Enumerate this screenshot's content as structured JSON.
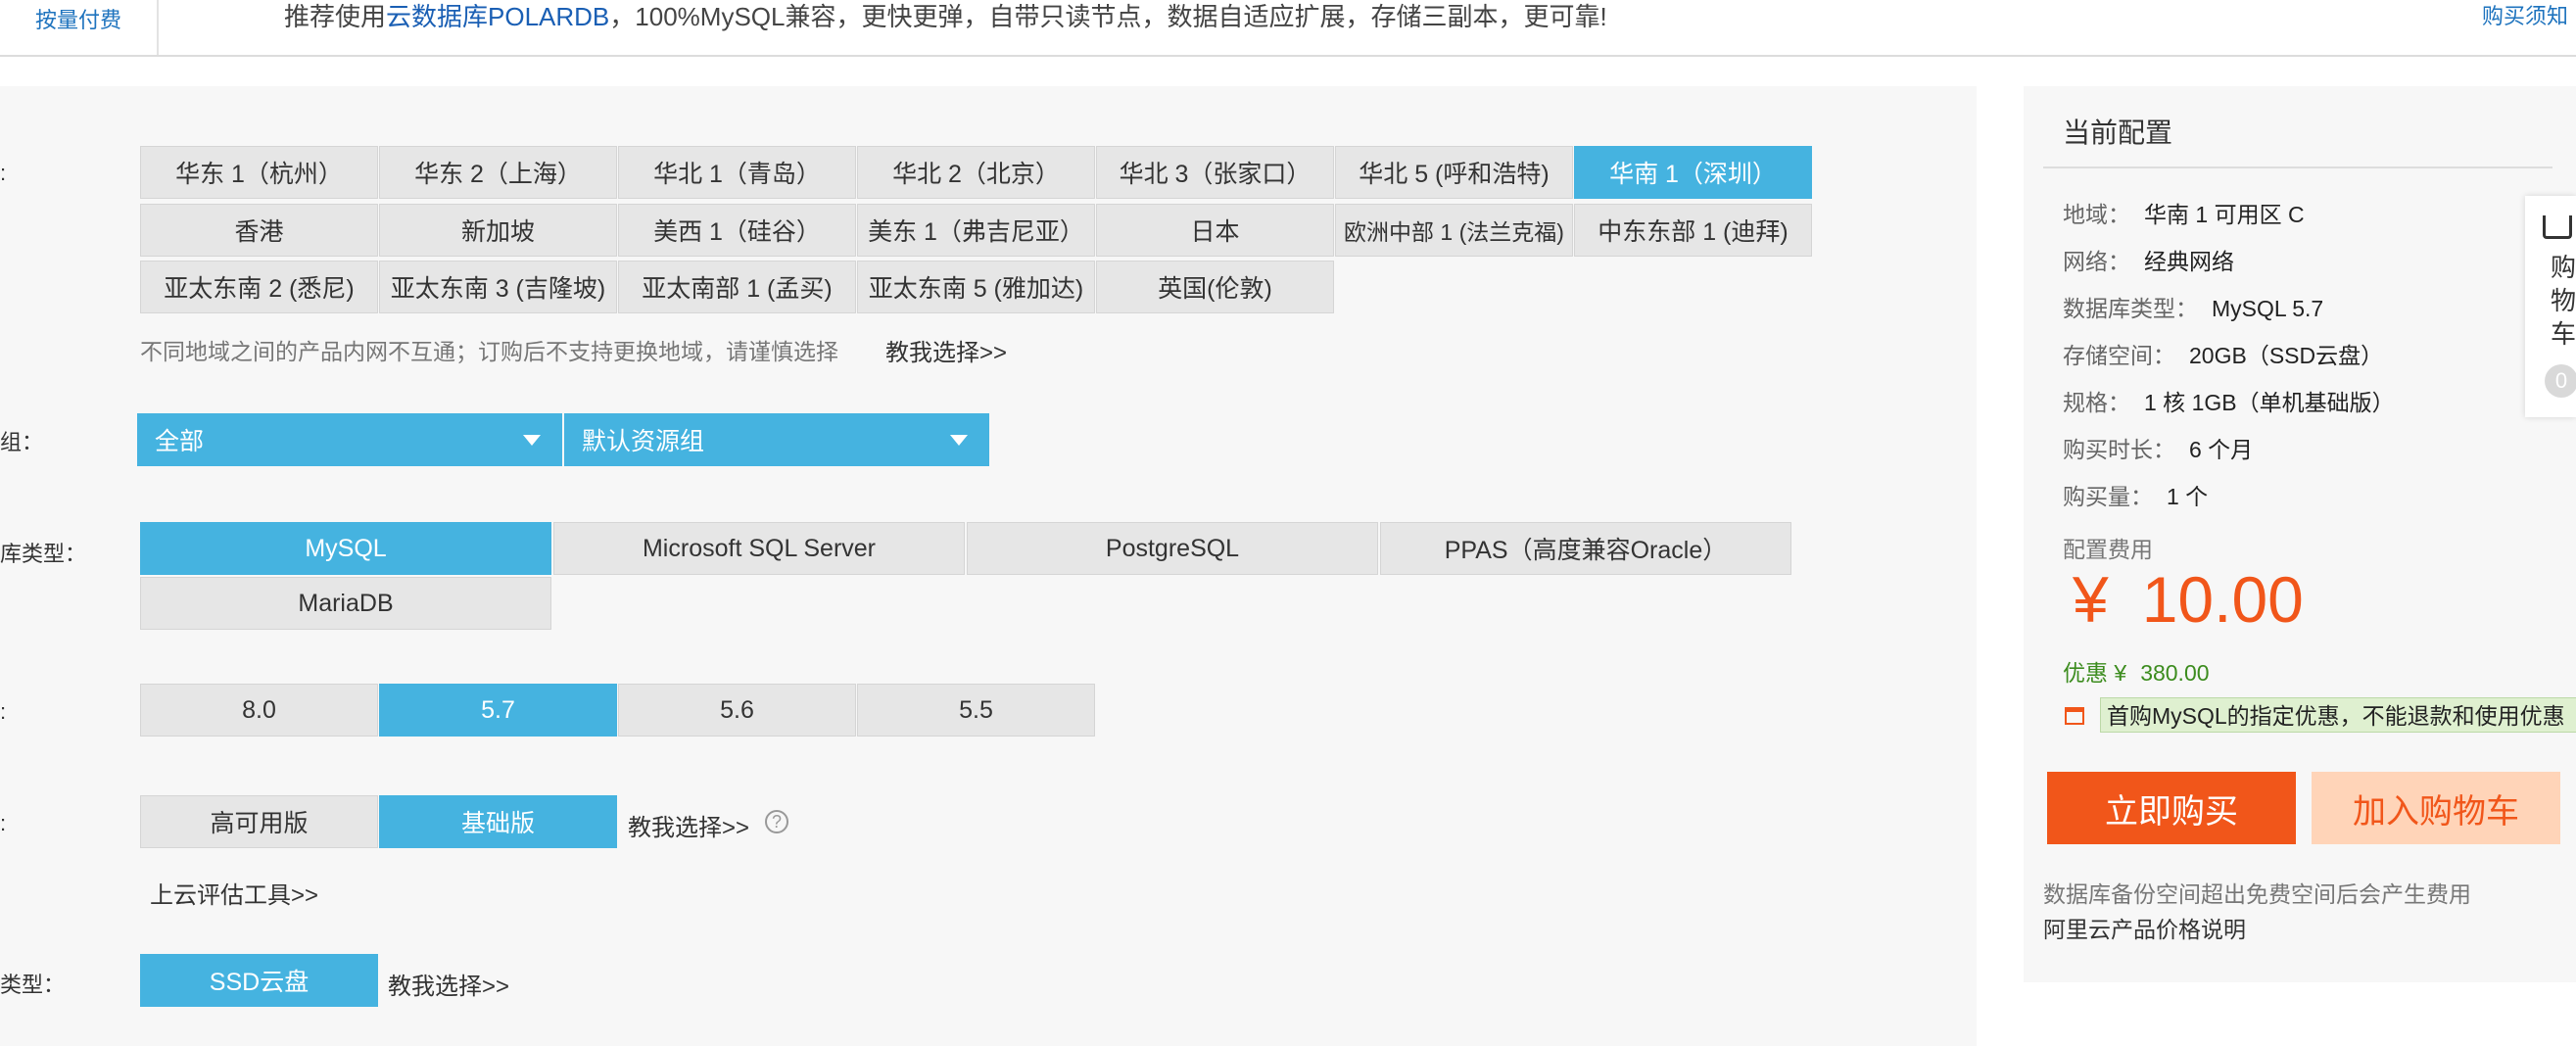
{
  "topbar": {
    "tab_label": "按量付费",
    "notice_prefix": "推荐使用",
    "notice_link": "云数据库POLARDB",
    "notice_rest": "，100%MySQL兼容，更快更弹，自带只读节点，数据自适应扩展，存储三副本，更可靠!",
    "right_link": "购买须知"
  },
  "region": {
    "label": ":",
    "options": [
      "华东 1（杭州）",
      "华东 2（上海）",
      "华北 1（青岛）",
      "华北 2（北京）",
      "华北 3（张家口）",
      "华北 5 (呼和浩特)",
      "华南 1（深圳）",
      "香港",
      "新加坡",
      "美西 1（硅谷）",
      "美东 1（弗吉尼亚）",
      "日本",
      "欧洲中部 1 (法兰克福)",
      "中东东部 1 (迪拜)",
      "亚太东南 2 (悉尼)",
      "亚太东南 3 (吉隆坡)",
      "亚太南部 1 (孟买)",
      "亚太东南 5 (雅加达)",
      "英国(伦敦)"
    ],
    "selected": "华南 1（深圳）",
    "hint": "不同地域之间的产品内网不互通；订购后不支持更换地域，请谨慎选择",
    "teach": "教我选择>>"
  },
  "resource_group": {
    "label": "组：",
    "first": "全部",
    "second": "默认资源组"
  },
  "db_type": {
    "label": "库类型：",
    "options": [
      "MySQL",
      "Microsoft SQL Server",
      "PostgreSQL",
      "PPAS（高度兼容Oracle）",
      "MariaDB"
    ],
    "selected": "MySQL"
  },
  "version": {
    "label": ":",
    "options": [
      "8.0",
      "5.7",
      "5.6",
      "5.5"
    ],
    "selected": "5.7"
  },
  "edition": {
    "label": ":",
    "options": [
      "高可用版",
      "基础版"
    ],
    "selected": "基础版",
    "teach": "教我选择>>",
    "help_icon": "?",
    "tool_link": "上云评估工具>>"
  },
  "storage_type": {
    "label": "类型：",
    "options": [
      "SSD云盘"
    ],
    "selected": "SSD云盘",
    "teach": "教我选择>>"
  },
  "sidebar": {
    "title": "当前配置",
    "config": [
      {
        "k": "地域：",
        "v": "华南 1 可用区 C"
      },
      {
        "k": "网络：",
        "v": "经典网络"
      },
      {
        "k": "数据库类型：",
        "v": "MySQL 5.7"
      },
      {
        "k": "存储空间：",
        "v": "20GB（SSD云盘）"
      },
      {
        "k": "规格：",
        "v": "1 核 1GB（单机基础版）"
      },
      {
        "k": "购买时长：",
        "v": "6 个月"
      },
      {
        "k": "购买量：",
        "v": "1 个"
      }
    ],
    "fee_label": "配置费用",
    "currency": "¥",
    "price": "10.00",
    "discount_label": "优惠 ¥",
    "discount_value": "380.00",
    "promo": "首购MySQL的指定优惠，不能退款和使用优惠",
    "buy_label": "立即购买",
    "cart_label": "加入购物车",
    "note": "数据库备份空间超出免费空间后会产生费用",
    "price_link": "阿里云产品价格说明"
  },
  "float_cart": {
    "text": "购物车",
    "count": "0"
  },
  "colors": {
    "accent": "#45b3e0",
    "orange": "#f1561a",
    "green": "#3c8c1e"
  }
}
